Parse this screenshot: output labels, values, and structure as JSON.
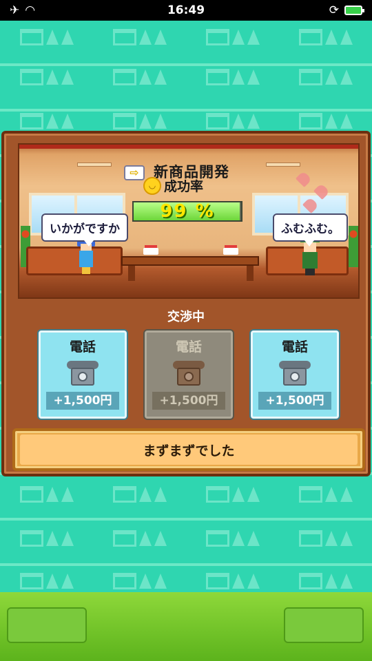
{
  "status_bar": {
    "time": "16:49",
    "icons": [
      "airplane-icon",
      "wifi-icon",
      "rotation-lock-icon",
      "battery-charging-icon"
    ]
  },
  "scene": {
    "title": "新商品開発",
    "rate_label": "成功率",
    "rate_value": "99 %",
    "rate_fraction": 0.99,
    "speech_left": "いかがですか",
    "speech_right": "ふむふむ。"
  },
  "negotiation": {
    "status": "交渉中",
    "cards": [
      {
        "label": "電話",
        "price": "+1,500円",
        "enabled": true
      },
      {
        "label": "電話",
        "price": "+1,500円",
        "enabled": false
      },
      {
        "label": "電話",
        "price": "+1,500円",
        "enabled": true
      }
    ],
    "result": "まずまずでした"
  },
  "colors": {
    "background": "#2fd6b0",
    "dialog": "#a2552a",
    "card_active": "#8fe3f0",
    "card_disabled": "#8f8a7c",
    "result_button": "#ffc97a",
    "bottom_bar": "#8ed83a"
  }
}
